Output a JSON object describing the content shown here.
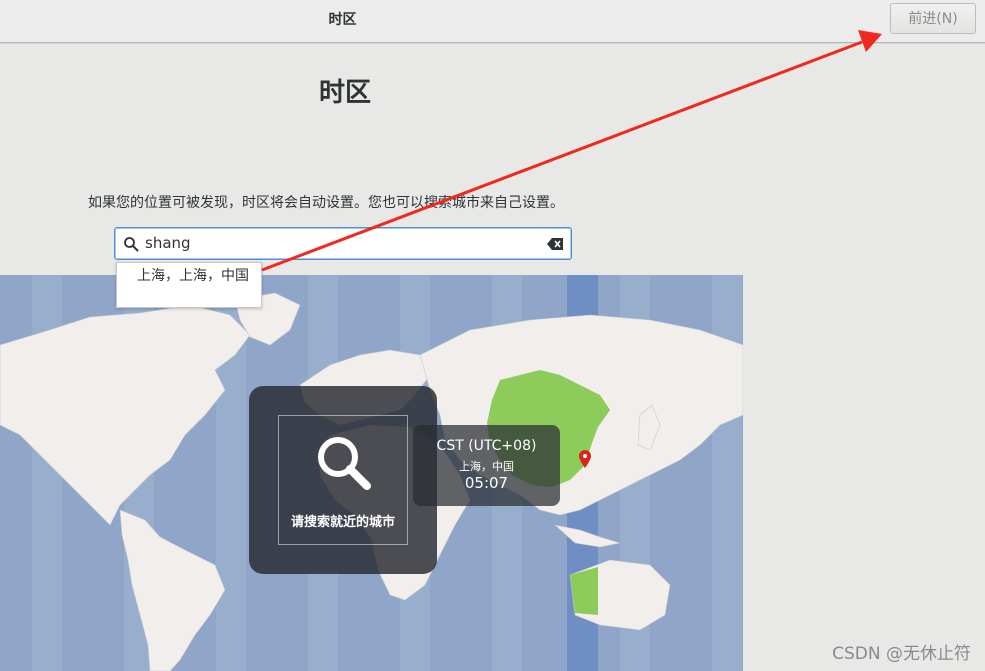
{
  "header": {
    "title": "时区",
    "next_label": "前进(N)"
  },
  "page": {
    "title": "时区",
    "hint": "如果您的位置可被发现，时区将会自动设置。您也可以搜索城市来自己设置。"
  },
  "search": {
    "value": "shang"
  },
  "suggestions": [
    "上海，上海，中国"
  ],
  "map_overlay": {
    "label": "请搜索就近的城市"
  },
  "timezone_popup": {
    "name": "CST (UTC+08)",
    "city": "上海，中国",
    "time": "05:07"
  },
  "watermark": "CSDN @无休止符",
  "colors": {
    "ocean": "#8fa6c8",
    "land": "#f1eeec",
    "selected_zone_band": "#6f8fc4",
    "selected_country": "#8dcc5b",
    "accent": "#4a90d9",
    "annotation_arrow": "#f0281e"
  }
}
